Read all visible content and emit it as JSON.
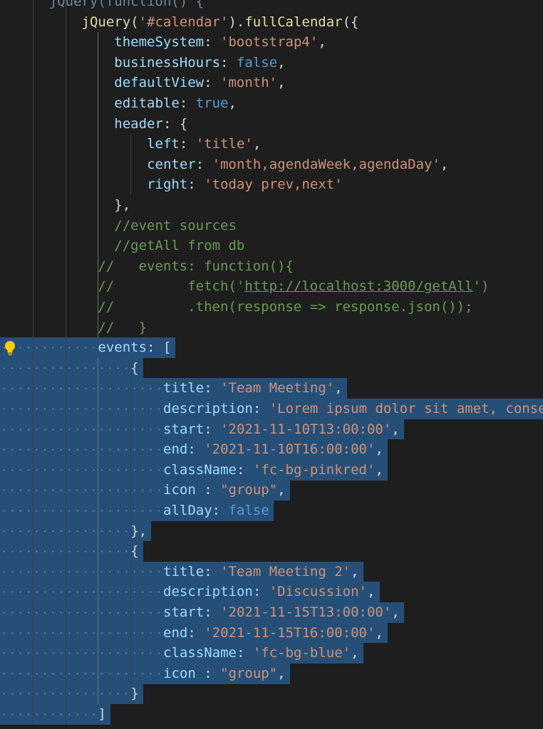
{
  "editor": {
    "colors": {
      "background": "#1e1e1e",
      "selection": "#264f78",
      "property": "#9cdcfe",
      "string": "#ce9178",
      "keyword": "#569cd6",
      "function": "#dcdcaa",
      "punctuation": "#d4d4d4",
      "comment": "#6a9955"
    },
    "lightbulb_icon": "lightbulb-icon",
    "lines": [
      {
        "indent": 6,
        "tokens": [
          [
            "fade",
            "jQuery(function() {"
          ]
        ]
      },
      {
        "indent": 10,
        "tokens": [
          [
            "fn",
            "jQuery"
          ],
          [
            "pn",
            "("
          ],
          [
            "str",
            "'#calendar'"
          ],
          [
            "pn",
            ")."
          ],
          [
            "fn",
            "fullCalendar"
          ],
          [
            "pn",
            "({"
          ]
        ]
      },
      {
        "indent": 14,
        "tokens": [
          [
            "prop",
            "themeSystem"
          ],
          [
            "pn",
            ": "
          ],
          [
            "str",
            "'bootstrap4'"
          ],
          [
            "pn",
            ","
          ]
        ]
      },
      {
        "indent": 14,
        "tokens": [
          [
            "prop",
            "businessHours"
          ],
          [
            "pn",
            ": "
          ],
          [
            "kw",
            "false"
          ],
          [
            "pn",
            ","
          ]
        ]
      },
      {
        "indent": 14,
        "tokens": [
          [
            "prop",
            "defaultView"
          ],
          [
            "pn",
            ": "
          ],
          [
            "str",
            "'month'"
          ],
          [
            "pn",
            ","
          ]
        ]
      },
      {
        "indent": 14,
        "tokens": [
          [
            "prop",
            "editable"
          ],
          [
            "pn",
            ": "
          ],
          [
            "kw",
            "true"
          ],
          [
            "pn",
            ","
          ]
        ]
      },
      {
        "indent": 14,
        "tokens": [
          [
            "prop",
            "header"
          ],
          [
            "pn",
            ": {"
          ]
        ]
      },
      {
        "indent": 18,
        "tokens": [
          [
            "prop",
            "left"
          ],
          [
            "pn",
            ": "
          ],
          [
            "str",
            "'title'"
          ],
          [
            "pn",
            ","
          ]
        ]
      },
      {
        "indent": 18,
        "tokens": [
          [
            "prop",
            "center"
          ],
          [
            "pn",
            ": "
          ],
          [
            "str",
            "'month,agendaWeek,agendaDay'"
          ],
          [
            "pn",
            ","
          ]
        ]
      },
      {
        "indent": 18,
        "tokens": [
          [
            "prop",
            "right"
          ],
          [
            "pn",
            ": "
          ],
          [
            "str",
            "'today prev,next'"
          ]
        ]
      },
      {
        "indent": 14,
        "tokens": [
          [
            "pn",
            "},"
          ]
        ]
      },
      {
        "indent": 14,
        "tokens": [
          [
            "cm",
            "//event sources"
          ]
        ]
      },
      {
        "indent": 14,
        "tokens": [
          [
            "cm",
            "//getAll from db"
          ]
        ]
      },
      {
        "indent": 12,
        "tokens": [
          [
            "cm",
            "//   events: function(){"
          ]
        ]
      },
      {
        "indent": 12,
        "tokens": [
          [
            "cm",
            "//         fetch('"
          ],
          [
            "link",
            "http://localhost:3000/getAll"
          ],
          [
            "cm",
            "')"
          ]
        ]
      },
      {
        "indent": 12,
        "tokens": [
          [
            "cm",
            "//         .then(response => response.json());"
          ]
        ]
      },
      {
        "indent": 12,
        "tokens": [
          [
            "cm",
            "//   }"
          ]
        ]
      },
      {
        "indent": 12,
        "tokens": [
          [
            "prop",
            "events"
          ],
          [
            "pn",
            ": ["
          ]
        ]
      },
      {
        "indent": 16,
        "tokens": [
          [
            "pn",
            "{"
          ]
        ]
      },
      {
        "indent": 20,
        "tokens": [
          [
            "prop",
            "title"
          ],
          [
            "pn",
            ": "
          ],
          [
            "str",
            "'Team Meeting'"
          ],
          [
            "pn",
            ","
          ]
        ]
      },
      {
        "indent": 20,
        "tokens": [
          [
            "prop",
            "description"
          ],
          [
            "pn",
            ": "
          ],
          [
            "str",
            "'Lorem ipsum dolor sit amet, conse"
          ]
        ]
      },
      {
        "indent": 20,
        "tokens": [
          [
            "prop",
            "start"
          ],
          [
            "pn",
            ": "
          ],
          [
            "str",
            "'2021-11-10T13:00:00'"
          ],
          [
            "pn",
            ","
          ]
        ]
      },
      {
        "indent": 20,
        "tokens": [
          [
            "prop",
            "end"
          ],
          [
            "pn",
            ": "
          ],
          [
            "str",
            "'2021-11-10T16:00:00'"
          ],
          [
            "pn",
            ","
          ]
        ]
      },
      {
        "indent": 20,
        "tokens": [
          [
            "prop",
            "className"
          ],
          [
            "pn",
            ": "
          ],
          [
            "str",
            "'fc-bg-pinkred'"
          ],
          [
            "pn",
            ","
          ]
        ]
      },
      {
        "indent": 20,
        "tokens": [
          [
            "prop",
            "icon"
          ],
          [
            "pn",
            " : "
          ],
          [
            "str",
            "\"group\""
          ],
          [
            "pn",
            ","
          ]
        ]
      },
      {
        "indent": 20,
        "tokens": [
          [
            "prop",
            "allDay"
          ],
          [
            "pn",
            ": "
          ],
          [
            "kw",
            "false"
          ]
        ]
      },
      {
        "indent": 16,
        "tokens": [
          [
            "pn",
            "},"
          ]
        ]
      },
      {
        "indent": 16,
        "tokens": [
          [
            "pn",
            "{"
          ]
        ]
      },
      {
        "indent": 20,
        "tokens": [
          [
            "prop",
            "title"
          ],
          [
            "pn",
            ": "
          ],
          [
            "str",
            "'Team Meeting 2'"
          ],
          [
            "pn",
            ","
          ]
        ]
      },
      {
        "indent": 20,
        "tokens": [
          [
            "prop",
            "description"
          ],
          [
            "pn",
            ": "
          ],
          [
            "str",
            "'Discussion'"
          ],
          [
            "pn",
            ","
          ]
        ]
      },
      {
        "indent": 20,
        "tokens": [
          [
            "prop",
            "start"
          ],
          [
            "pn",
            ": "
          ],
          [
            "str",
            "'2021-11-15T13:00:00'"
          ],
          [
            "pn",
            ","
          ]
        ]
      },
      {
        "indent": 20,
        "tokens": [
          [
            "prop",
            "end"
          ],
          [
            "pn",
            ": "
          ],
          [
            "str",
            "'2021-11-15T16:00:00'"
          ],
          [
            "pn",
            ","
          ]
        ]
      },
      {
        "indent": 20,
        "tokens": [
          [
            "prop",
            "className"
          ],
          [
            "pn",
            ": "
          ],
          [
            "str",
            "'fc-bg-blue'"
          ],
          [
            "pn",
            ","
          ]
        ]
      },
      {
        "indent": 20,
        "tokens": [
          [
            "prop",
            "icon"
          ],
          [
            "pn",
            " : "
          ],
          [
            "str",
            "\"group\""
          ],
          [
            "pn",
            ","
          ]
        ]
      },
      {
        "indent": 16,
        "tokens": [
          [
            "pn",
            "}"
          ]
        ]
      },
      {
        "indent": 12,
        "tokens": [
          [
            "pn",
            "]"
          ]
        ]
      }
    ]
  }
}
